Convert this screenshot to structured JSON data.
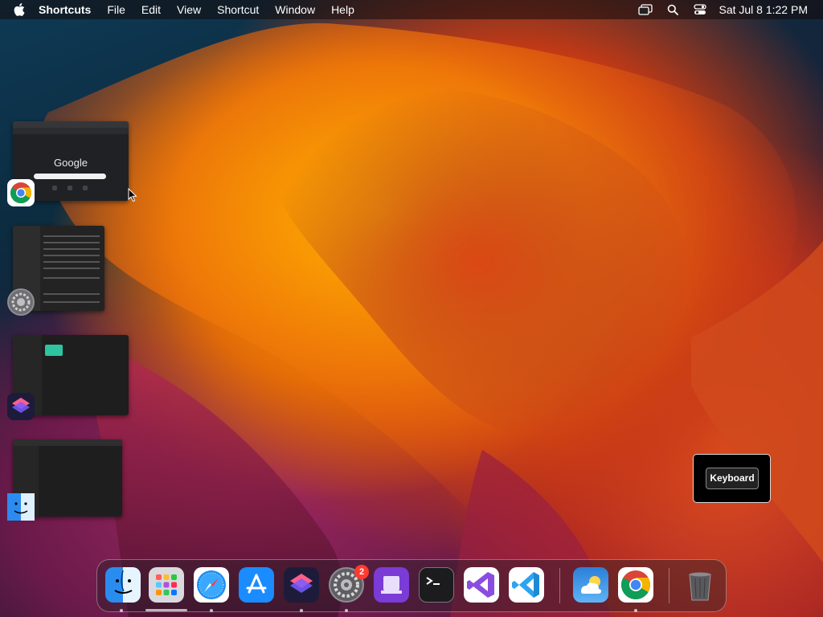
{
  "menubar": {
    "app_name": "Shortcuts",
    "menus": [
      "File",
      "Edit",
      "View",
      "Shortcut",
      "Window",
      "Help"
    ],
    "clock": "Sat Jul 8  1:22 PM",
    "status_icons": [
      "screen-mirroring-icon",
      "spotlight-search-icon",
      "control-center-icon"
    ]
  },
  "windows": [
    {
      "app": "Google Chrome",
      "icon": "chrome-icon",
      "content_text": "Google"
    },
    {
      "app": "System Settings",
      "icon": "system-settings-icon"
    },
    {
      "app": "Shortcuts",
      "icon": "shortcuts-icon"
    },
    {
      "app": "Finder",
      "icon": "finder-icon"
    }
  ],
  "tooltip": {
    "label": "Keyboard"
  },
  "dock": {
    "apps": [
      {
        "name": "Finder",
        "icon": "finder-icon",
        "running": true
      },
      {
        "name": "Launchpad",
        "icon": "launchpad-icon",
        "running": false
      },
      {
        "name": "Safari",
        "icon": "safari-icon",
        "running": true
      },
      {
        "name": "App Store",
        "icon": "app-store-icon",
        "running": false
      },
      {
        "name": "Shortcuts",
        "icon": "shortcuts-icon",
        "running": true
      },
      {
        "name": "System Settings",
        "icon": "system-settings-icon",
        "running": true,
        "badge": "2"
      },
      {
        "name": "Apple Configurator",
        "icon": "apple-configurator-icon",
        "running": false
      },
      {
        "name": "Terminal",
        "icon": "terminal-icon",
        "running": false
      },
      {
        "name": "Visual Studio",
        "icon": "visual-studio-icon",
        "running": false
      },
      {
        "name": "Visual Studio Code",
        "icon": "vscode-icon",
        "running": false
      },
      {
        "name": "Weather",
        "icon": "weather-icon",
        "running": false
      },
      {
        "name": "Google Chrome",
        "icon": "chrome-icon",
        "running": true
      },
      {
        "name": "Trash",
        "icon": "trash-icon",
        "running": false
      }
    ]
  },
  "colors": {
    "accent_badge": "#ff3b30",
    "menubar_text": "#ffffff"
  }
}
